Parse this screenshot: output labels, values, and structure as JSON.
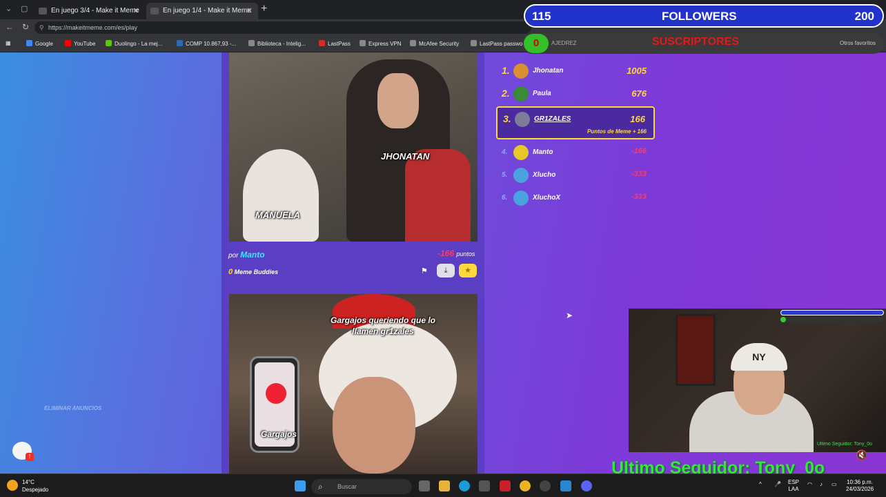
{
  "browser": {
    "tabs": [
      {
        "label": "En juego 3/4 - Make it Meme"
      },
      {
        "label": "En juego 1/4 - Make it Meme"
      }
    ],
    "url": "https://makeitmeme.com/es/play",
    "bookmarks": [
      {
        "label": "Google",
        "color": "#4285f4"
      },
      {
        "label": "YouTube",
        "color": "#ff0000"
      },
      {
        "label": "Duolingo - La mej...",
        "color": "#58cc02"
      },
      {
        "label": "COMP 10.867,93 -...",
        "color": "#2b6cb0"
      },
      {
        "label": "Biblioteca - Intelig...",
        "color": "#888888"
      },
      {
        "label": "LastPass",
        "color": "#d32d27"
      },
      {
        "label": "Express VPN",
        "color": "#888888"
      },
      {
        "label": "McAfee Security",
        "color": "#888888"
      },
      {
        "label": "LastPass passwo...",
        "color": "#888888"
      }
    ]
  },
  "game": {
    "meme1": {
      "caption_girl": "JHONATAN",
      "caption_dog": "MANUELA",
      "author_prefix": "por",
      "author": "Manto",
      "score": "-166",
      "score_unit": "puntos",
      "buddies_count": "0",
      "buddies_label": "Meme Buddies"
    },
    "meme2": {
      "caption_top": "Gargajos queriendo que lo llamen gr1zales",
      "caption_phone": "Gargajos"
    },
    "leaderboard": [
      {
        "rank": "1.",
        "name": "Jhonatan",
        "points": "1005",
        "avatar": "#d89030"
      },
      {
        "rank": "2.",
        "name": "Paula",
        "points": "676",
        "avatar": "#3a8a3a"
      },
      {
        "rank": "3.",
        "name": "GR1ZALES",
        "points": "166",
        "sub": "Puntos de Meme + 166",
        "avatar": "#7d7d9a"
      },
      {
        "rank": "4.",
        "name": "Manto",
        "points": "-166",
        "avatar": "#e6c82a"
      },
      {
        "rank": "5.",
        "name": "Xlucho",
        "points": "-333",
        "avatar": "#4aa3e0"
      },
      {
        "rank": "6.",
        "name": "XluchoX",
        "points": "-333",
        "avatar": "#4aa3e0"
      }
    ],
    "ads_label": "ELIMINAR ANUNCIOS"
  },
  "overlay": {
    "followers_count": "115",
    "followers_label": "FOLLOWERS",
    "followers_goal": "200",
    "subs_count": "0",
    "subs_label": "SUSCRIPTORES",
    "ajedrez": "AJEDREZ",
    "otros": "Otros favoritos",
    "last_follower": "Ultimo Seguidor: Tony_0o",
    "cam_cap_logo": "NY",
    "cam_last_sub": "Ultimo Seguidor: Tony_0o"
  },
  "taskbar": {
    "temp": "14°C",
    "weather": "Despejado",
    "search_placeholder": "Buscar",
    "lang1": "ESP",
    "lang2": "LAA",
    "time": "10:36 p.m.",
    "date": "24/03/2026"
  }
}
